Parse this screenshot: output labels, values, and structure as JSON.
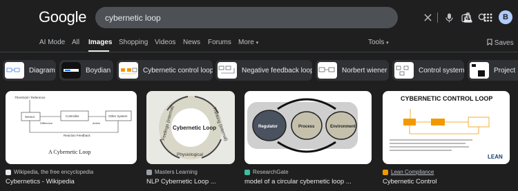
{
  "header": {
    "logo": "Google",
    "search_value": "cybernetic loop",
    "avatar_letter": "B"
  },
  "tabs": [
    {
      "label": "AI Mode"
    },
    {
      "label": "All"
    },
    {
      "label": "Images"
    },
    {
      "label": "Shopping"
    },
    {
      "label": "Videos"
    },
    {
      "label": "News"
    },
    {
      "label": "Forums"
    },
    {
      "label": "More"
    }
  ],
  "tools_label": "Tools",
  "saves_label": "Saves",
  "chips": [
    {
      "label": "Diagram"
    },
    {
      "label": "Boydian"
    },
    {
      "label": "Cybernetic control loop"
    },
    {
      "label": "Negative feedback loop"
    },
    {
      "label": "Norbert wiener"
    },
    {
      "label": "Control system"
    },
    {
      "label": "Project"
    }
  ],
  "results": [
    {
      "source": "Wikipedia, the free encyclopedia",
      "title": "Cybernetics - Wikipedia",
      "img_text": {
        "threshold": "Threshold / Reference",
        "sensor": "Sensor",
        "controller": "Controller",
        "other": "Other System",
        "difference": "Difference",
        "action": "Action",
        "feedback": "Reaction Feedback",
        "caption": "A Cybernetic Loop"
      }
    },
    {
      "source": "Masters Learning",
      "title": "NLP Cybernetic Loop ...",
      "img_text": {
        "center": "Cybernetic Loop",
        "feelings": "Feelings (internal)",
        "thinking": "Thinking (internal)",
        "physiological": "Physiological"
      }
    },
    {
      "source": "ResearchGate",
      "title": "model of a circular cybernetic loop ...",
      "img_text": {
        "regulator": "Regulator",
        "process": "Process",
        "environment": "Environment"
      }
    },
    {
      "source": "Lean Compliance",
      "title": "Cybernetic Control",
      "img_text": {
        "heading": "CYBERNETIC CONTROL LOOP",
        "brand": "LEAN"
      }
    }
  ],
  "colors": {
    "background": "#1f1f1f",
    "search_bg": "#4d5156",
    "chip_bg": "#303134",
    "accent_orange": "#f29900"
  }
}
